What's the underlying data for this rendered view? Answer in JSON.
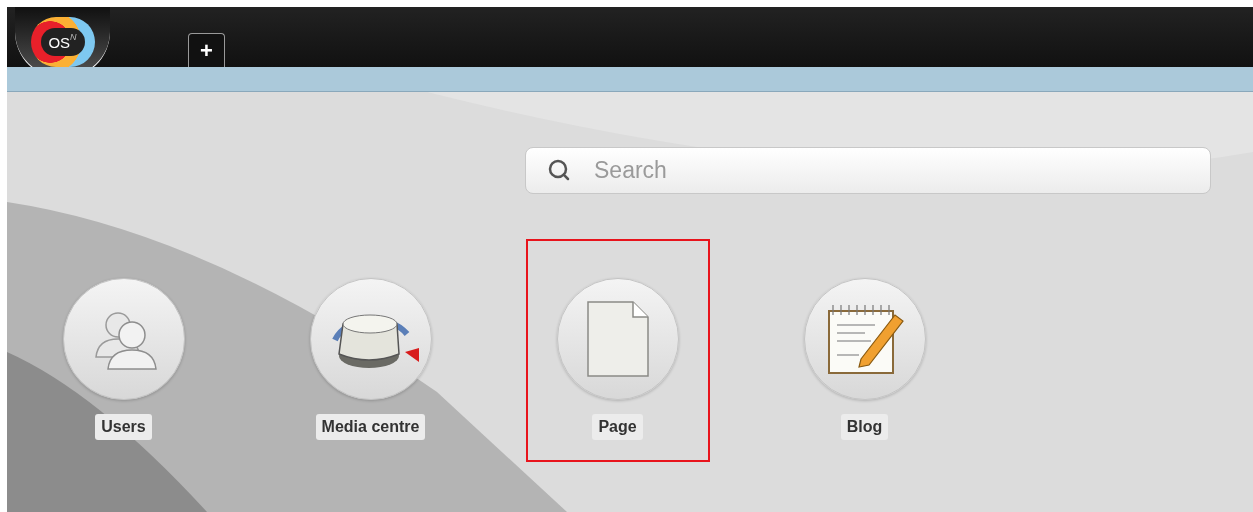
{
  "logo": {
    "text": "OS",
    "superscript": "N"
  },
  "header": {
    "add_tab": "+"
  },
  "search": {
    "placeholder": "Search"
  },
  "apps": [
    {
      "kind": "users",
      "label": "Users",
      "highlighted": false
    },
    {
      "kind": "media",
      "label": "Media centre",
      "highlighted": false
    },
    {
      "kind": "page",
      "label": "Page",
      "highlighted": true
    },
    {
      "kind": "blog",
      "label": "Blog",
      "highlighted": false
    }
  ]
}
